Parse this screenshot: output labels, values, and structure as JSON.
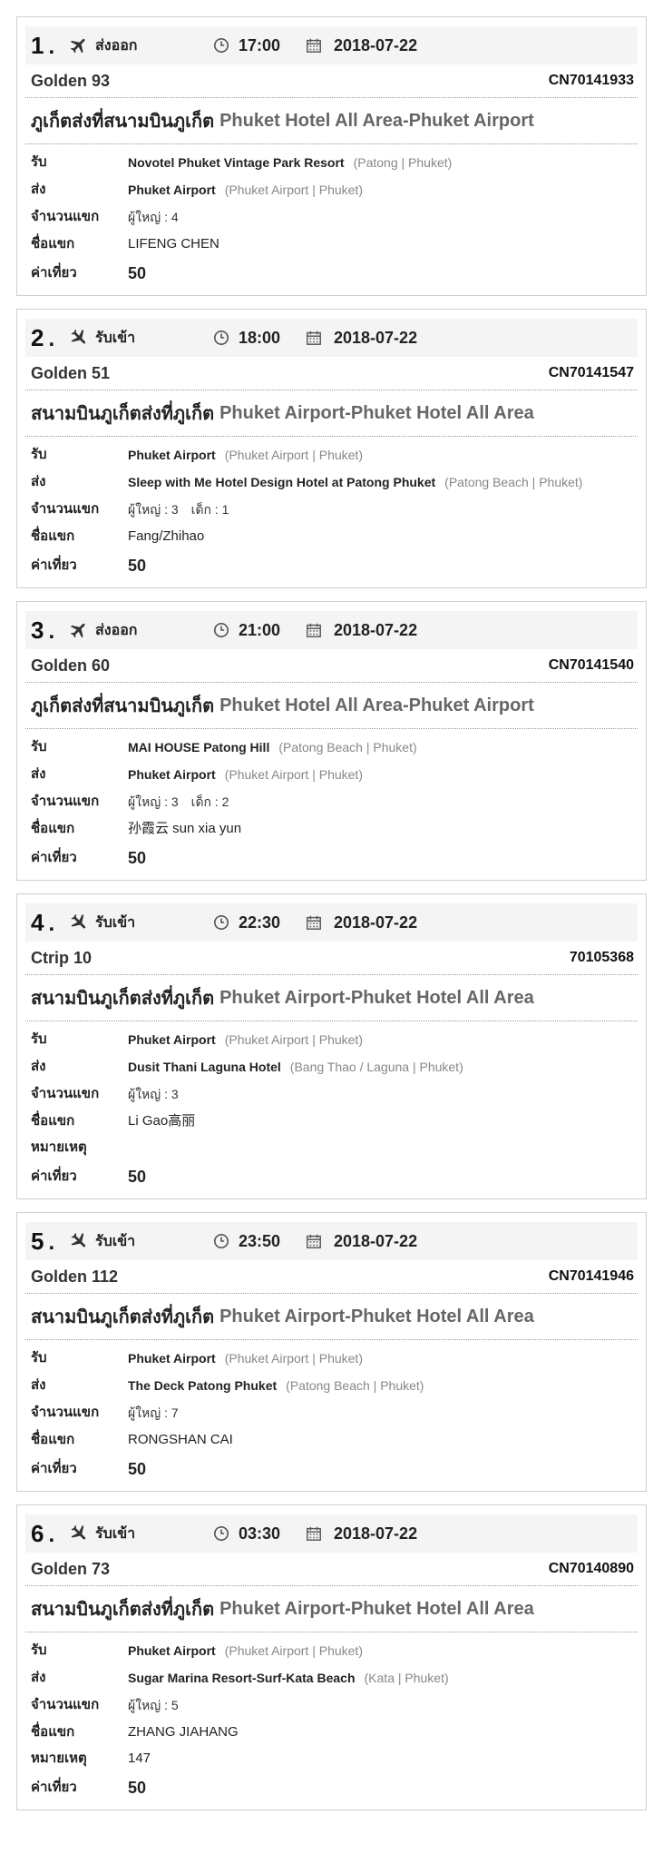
{
  "labels": {
    "pickup": "รับ",
    "dropoff": "ส่ง",
    "guests": "จำนวนแขก",
    "guest_name": "ชื่อแขก",
    "note": "หมายเหตุ",
    "fare": "ค่าเที่ยว",
    "adult": "ผู้ใหญ่",
    "child": "เด็ก"
  },
  "bookings": [
    {
      "num": "1",
      "dot": ".",
      "dir": "ส่งออก",
      "dir_type": "departure",
      "time": "17:00",
      "date": "2018-07-22",
      "vehicle": "Golden 93",
      "code": "CN70141933",
      "route_th": "ภูเก็ตส่งที่สนามบินภูเก็ต",
      "route_en": "Phuket Hotel All Area-Phuket Airport",
      "pickup": "Novotel Phuket Vintage Park Resort",
      "pickup_area": "(Patong | Phuket)",
      "dropoff": "Phuket Airport",
      "dropoff_area": "(Phuket Airport | Phuket)",
      "adults": "ผู้ใหญ่ : 4",
      "children": "",
      "guest": "LIFENG CHEN",
      "note": null,
      "fare": "50"
    },
    {
      "num": "2",
      "dot": ".",
      "dir": "รับเข้า",
      "dir_type": "arrival",
      "time": "18:00",
      "date": "2018-07-22",
      "vehicle": "Golden 51",
      "code": "CN70141547",
      "route_th": "สนามบินภูเก็ตส่งที่ภูเก็ต",
      "route_en": "Phuket Airport-Phuket Hotel All Area",
      "pickup": "Phuket Airport",
      "pickup_area": "(Phuket Airport | Phuket)",
      "dropoff": "Sleep with Me Hotel Design Hotel at Patong Phuket",
      "dropoff_area": "(Patong Beach | Phuket)",
      "adults": "ผู้ใหญ่ : 3",
      "children": "เด็ก : 1",
      "guest": "Fang/Zhihao",
      "note": null,
      "fare": "50"
    },
    {
      "num": "3",
      "dot": ".",
      "dir": "ส่งออก",
      "dir_type": "departure",
      "time": "21:00",
      "date": "2018-07-22",
      "vehicle": "Golden 60",
      "code": "CN70141540",
      "route_th": "ภูเก็ตส่งที่สนามบินภูเก็ต",
      "route_en": "Phuket Hotel All Area-Phuket Airport",
      "pickup": "MAI HOUSE Patong Hill",
      "pickup_area": "(Patong Beach | Phuket)",
      "dropoff": "Phuket Airport",
      "dropoff_area": "(Phuket Airport | Phuket)",
      "adults": "ผู้ใหญ่ : 3",
      "children": "เด็ก : 2",
      "guest": "孙霞云 sun xia yun",
      "note": null,
      "fare": "50"
    },
    {
      "num": "4",
      "dot": ".",
      "dir": "รับเข้า",
      "dir_type": "arrival",
      "time": "22:30",
      "date": "2018-07-22",
      "vehicle": "Ctrip 10",
      "code": "70105368",
      "route_th": "สนามบินภูเก็ตส่งที่ภูเก็ต",
      "route_en": "Phuket Airport-Phuket Hotel All Area",
      "pickup": "Phuket Airport",
      "pickup_area": "(Phuket Airport | Phuket)",
      "dropoff": "Dusit Thani Laguna Hotel",
      "dropoff_area": "(Bang Thao / Laguna | Phuket)",
      "adults": "ผู้ใหญ่ : 3",
      "children": "",
      "guest": "Li Gao高丽",
      "note": "",
      "fare": "50"
    },
    {
      "num": "5",
      "dot": ".",
      "dir": "รับเข้า",
      "dir_type": "arrival",
      "time": "23:50",
      "date": "2018-07-22",
      "vehicle": "Golden 112",
      "code": "CN70141946",
      "route_th": "สนามบินภูเก็ตส่งที่ภูเก็ต",
      "route_en": "Phuket Airport-Phuket Hotel All Area",
      "pickup": "Phuket Airport",
      "pickup_area": "(Phuket Airport | Phuket)",
      "dropoff": "The Deck Patong Phuket",
      "dropoff_area": "(Patong Beach | Phuket)",
      "adults": "ผู้ใหญ่ : 7",
      "children": "",
      "guest": "RONGSHAN CAI",
      "note": null,
      "fare": "50"
    },
    {
      "num": "6",
      "dot": ".",
      "dir": "รับเข้า",
      "dir_type": "arrival",
      "time": "03:30",
      "date": "2018-07-22",
      "vehicle": "Golden 73",
      "code": "CN70140890",
      "route_th": "สนามบินภูเก็ตส่งที่ภูเก็ต",
      "route_en": "Phuket Airport-Phuket Hotel All Area",
      "pickup": "Phuket Airport",
      "pickup_area": "(Phuket Airport | Phuket)",
      "dropoff": "Sugar Marina Resort-Surf-Kata Beach",
      "dropoff_area": "(Kata | Phuket)",
      "adults": "ผู้ใหญ่ : 5",
      "children": "",
      "guest": "ZHANG JIAHANG",
      "note": "147",
      "fare": "50"
    }
  ],
  "icons": {
    "departure": "plane-departure-icon",
    "arrival": "plane-arrival-icon",
    "time": "clock-icon",
    "date": "calendar-icon"
  }
}
